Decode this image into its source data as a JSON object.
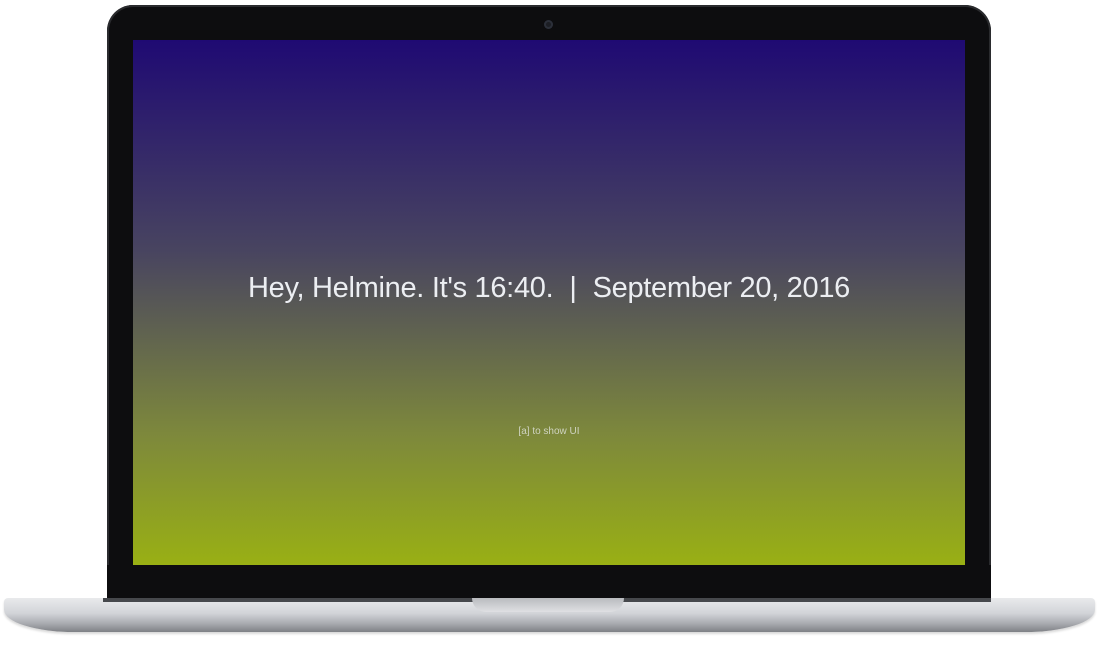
{
  "screen": {
    "greeting": "Hey, Helmine. It's 16:40.",
    "separator": "|",
    "date": "September 20, 2016",
    "hint": "[a] to show UI"
  },
  "colors": {
    "gradient_top": "#1f0a73",
    "gradient_middle": "#484460",
    "gradient_bottom": "#99b014",
    "text": "#eceef2"
  }
}
